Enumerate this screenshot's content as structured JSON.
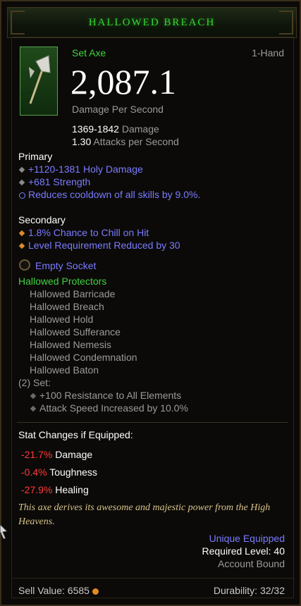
{
  "item": {
    "name": "HALLOWED BREACH",
    "type": "Set Axe",
    "hand": "1-Hand",
    "dps": "2,087.1",
    "dps_label": "Damage Per Second",
    "damage_range": "1369-1842",
    "damage_label": "Damage",
    "aps_value": "1.30",
    "aps_label": "Attacks per Second"
  },
  "primary": {
    "heading": "Primary",
    "stats": [
      "+1120-1381 Holy Damage",
      "+681 Strength",
      "Reduces cooldown of all skills by 9.0%."
    ]
  },
  "secondary": {
    "heading": "Secondary",
    "stats": [
      "1.8% Chance to Chill on Hit",
      "Level Requirement Reduced by 30"
    ]
  },
  "socket": {
    "label": "Empty Socket"
  },
  "set": {
    "name": "Hallowed Protectors",
    "pieces": [
      "Hallowed Barricade",
      "Hallowed Breach",
      "Hallowed Hold",
      "Hallowed Sufferance",
      "Hallowed Nemesis",
      "Hallowed Condemnation",
      "Hallowed Baton"
    ],
    "bonus_heading": "(2) Set:",
    "bonuses": [
      "+100 Resistance to All Elements",
      "Attack Speed Increased by 10.0%"
    ]
  },
  "stat_changes": {
    "heading": "Stat Changes if Equipped:",
    "rows": [
      {
        "value": "-21.7%",
        "label": "Damage"
      },
      {
        "value": "-0.4%",
        "label": "Toughness"
      },
      {
        "value": "-27.9%",
        "label": "Healing"
      }
    ]
  },
  "flavor": "This axe derives its awesome and majestic power from the High Heavens.",
  "footer": {
    "unique": "Unique Equipped",
    "required_level": "Required Level: 40",
    "bound": "Account Bound",
    "sell_value": "Sell Value: 6585",
    "durability": "Durability: 32/32"
  },
  "colors": {
    "title_green": "#35d735",
    "set_green": "#3fd33f",
    "magic_blue": "#7b7bff",
    "negative_red": "#ff3b3b",
    "flavor_gold": "#d9c38a"
  },
  "icons": [
    "axe-icon",
    "socket-icon",
    "gold-coin-icon",
    "diamond-bullet-icon",
    "cooldown-icon"
  ]
}
